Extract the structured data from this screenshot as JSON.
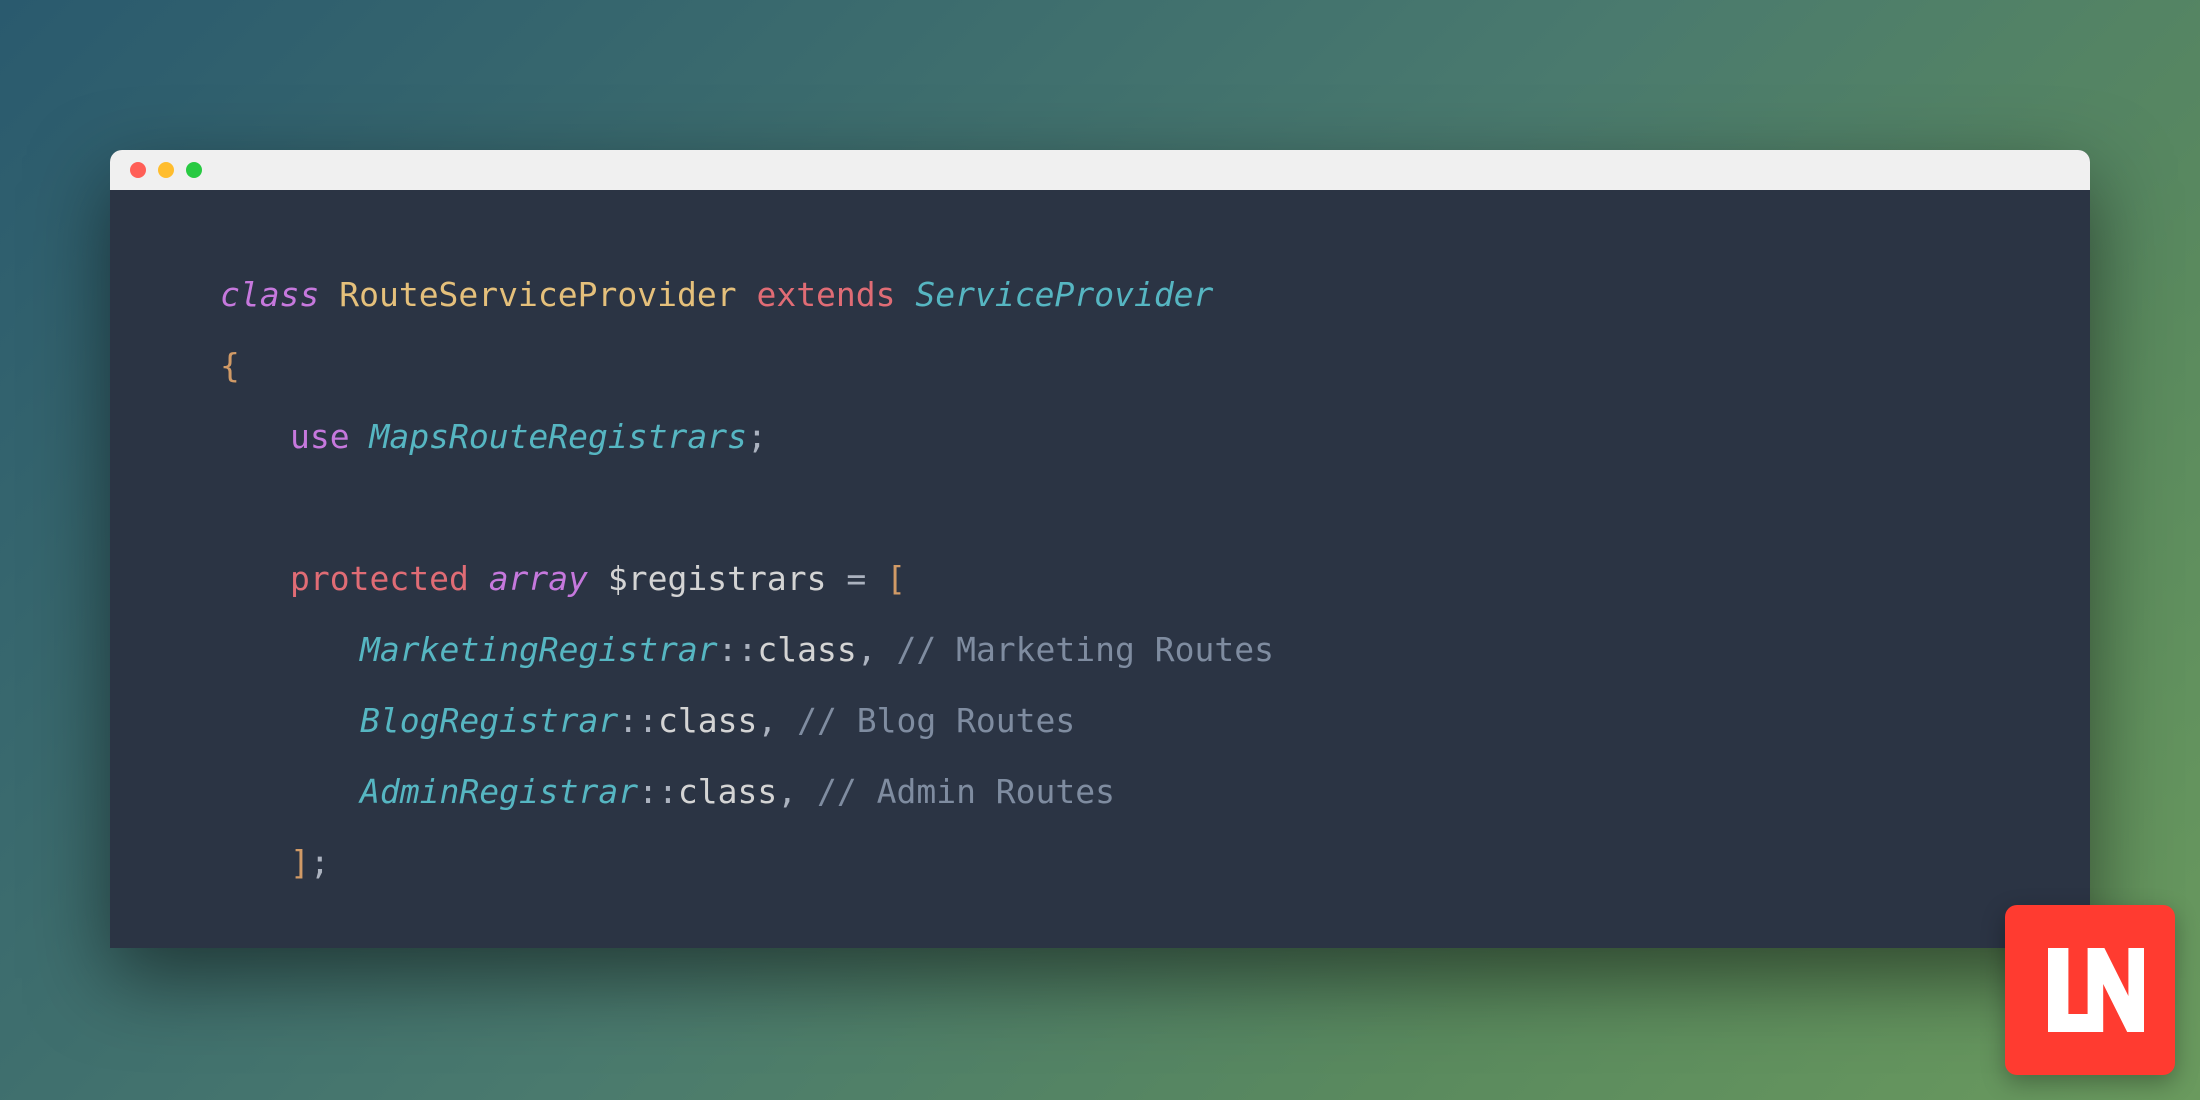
{
  "code": {
    "line1": {
      "class_kw": "class",
      "classname": "RouteServiceProvider",
      "extends_kw": "extends",
      "parent": "ServiceProvider"
    },
    "line2": {
      "brace": "{"
    },
    "line3": {
      "use_kw": "use",
      "trait": "MapsRouteRegistrars",
      "semi": ";"
    },
    "line4": {
      "protected_kw": "protected",
      "array_kw": "array",
      "var": "$registrars",
      "equals": " = ",
      "bracket": "["
    },
    "registrars": [
      {
        "classref": "MarketingRegistrar",
        "scope": "::",
        "class_kw": "class",
        "comma": ", ",
        "comment": "// Marketing Routes"
      },
      {
        "classref": "BlogRegistrar",
        "scope": "::",
        "class_kw": "class",
        "comma": ", ",
        "comment": "// Blog Routes"
      },
      {
        "classref": "AdminRegistrar",
        "scope": "::",
        "class_kw": "class",
        "comma": ", ",
        "comment": "// Admin Routes"
      }
    ],
    "line_close": {
      "bracket": "]",
      "semi": ";"
    }
  },
  "logo": {
    "text": "LN"
  }
}
